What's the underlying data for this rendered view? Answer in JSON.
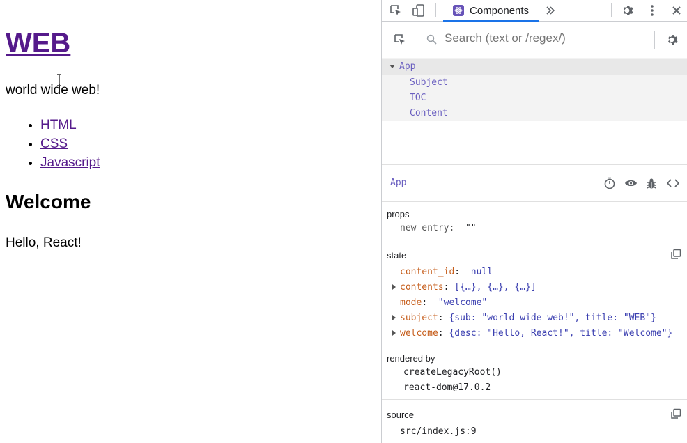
{
  "page": {
    "title": "WEB",
    "tagline": "world wide web!",
    "nav": [
      "HTML",
      "CSS",
      "Javascript"
    ],
    "welcome_title": "Welcome",
    "welcome_desc": "Hello, React!"
  },
  "devtools": {
    "tab_label": "Components",
    "search_placeholder": "Search (text or /regex/)",
    "tree": {
      "root": "App",
      "children": [
        "Subject",
        "TOC",
        "Content"
      ]
    },
    "selected_component": "App",
    "props": {
      "title": "props",
      "entry_key": "new entry",
      "entry_value": "\"\""
    },
    "state": {
      "title": "state",
      "items": [
        {
          "key": "content_id",
          "value": "null"
        },
        {
          "key": "contents",
          "value": "[{…}, {…}, {…}]"
        },
        {
          "key": "mode",
          "value": "\"welcome\""
        },
        {
          "key": "subject",
          "value": "{sub: \"world wide web!\", title: \"WEB\"}"
        },
        {
          "key": "welcome",
          "value": "{desc: \"Hello, React!\", title: \"Welcome\"}"
        }
      ]
    },
    "rendered_by": {
      "title": "rendered by",
      "items": [
        "createLegacyRoot()",
        "react-dom@17.0.2"
      ]
    },
    "source": {
      "title": "source",
      "value": "src/index.js:9"
    }
  },
  "colors": {
    "link_visited": "#551a8b",
    "accent_blue": "#1a73e8",
    "component_purple": "#6a5fc0",
    "state_key_orange": "#c65e1c"
  }
}
